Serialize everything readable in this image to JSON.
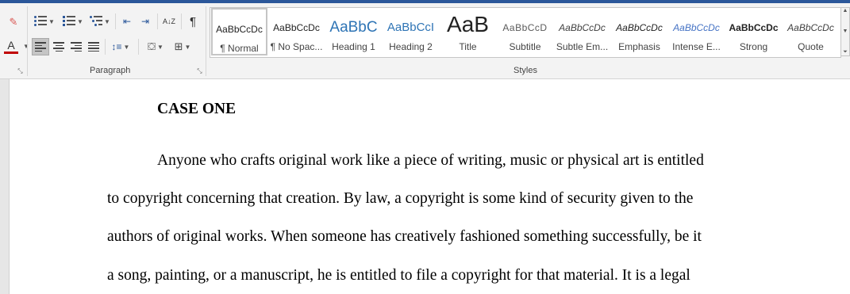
{
  "ribbon": {
    "paragraph_label": "Paragraph",
    "styles_label": "Styles",
    "font_color": "#c00000",
    "accent": "#2b579a",
    "font_color_letter": "A",
    "show_marks_glyph": "¶",
    "sort_glyph": "A↓Z"
  },
  "styles": [
    {
      "preview": "AaBbCcDc",
      "name": "¶ Normal"
    },
    {
      "preview": "AaBbCcDc",
      "name": "¶ No Spac..."
    },
    {
      "preview": "AaBbC",
      "name": "Heading 1"
    },
    {
      "preview": "AaBbCcI",
      "name": "Heading 2"
    },
    {
      "preview": "AaB",
      "name": "Title"
    },
    {
      "preview": "AaBbCcD",
      "name": "Subtitle"
    },
    {
      "preview": "AaBbCcDc",
      "name": "Subtle Em..."
    },
    {
      "preview": "AaBbCcDc",
      "name": "Emphasis"
    },
    {
      "preview": "AaBbCcDc",
      "name": "Intense E..."
    },
    {
      "preview": "AaBbCcDc",
      "name": "Strong"
    },
    {
      "preview": "AaBbCcDc",
      "name": "Quote"
    }
  ],
  "document": {
    "heading": "CASE ONE",
    "lines": [
      "Anyone who crafts original work like a piece of writing, music or physical art is entitled",
      "to copyright concerning that creation. By law, a copyright is some kind of security given to the",
      "authors of original works. When someone has creatively fashioned something successfully, be it",
      "a song, painting, or a manuscript, he is entitled to file a copyright for that material. It is a legal"
    ]
  }
}
